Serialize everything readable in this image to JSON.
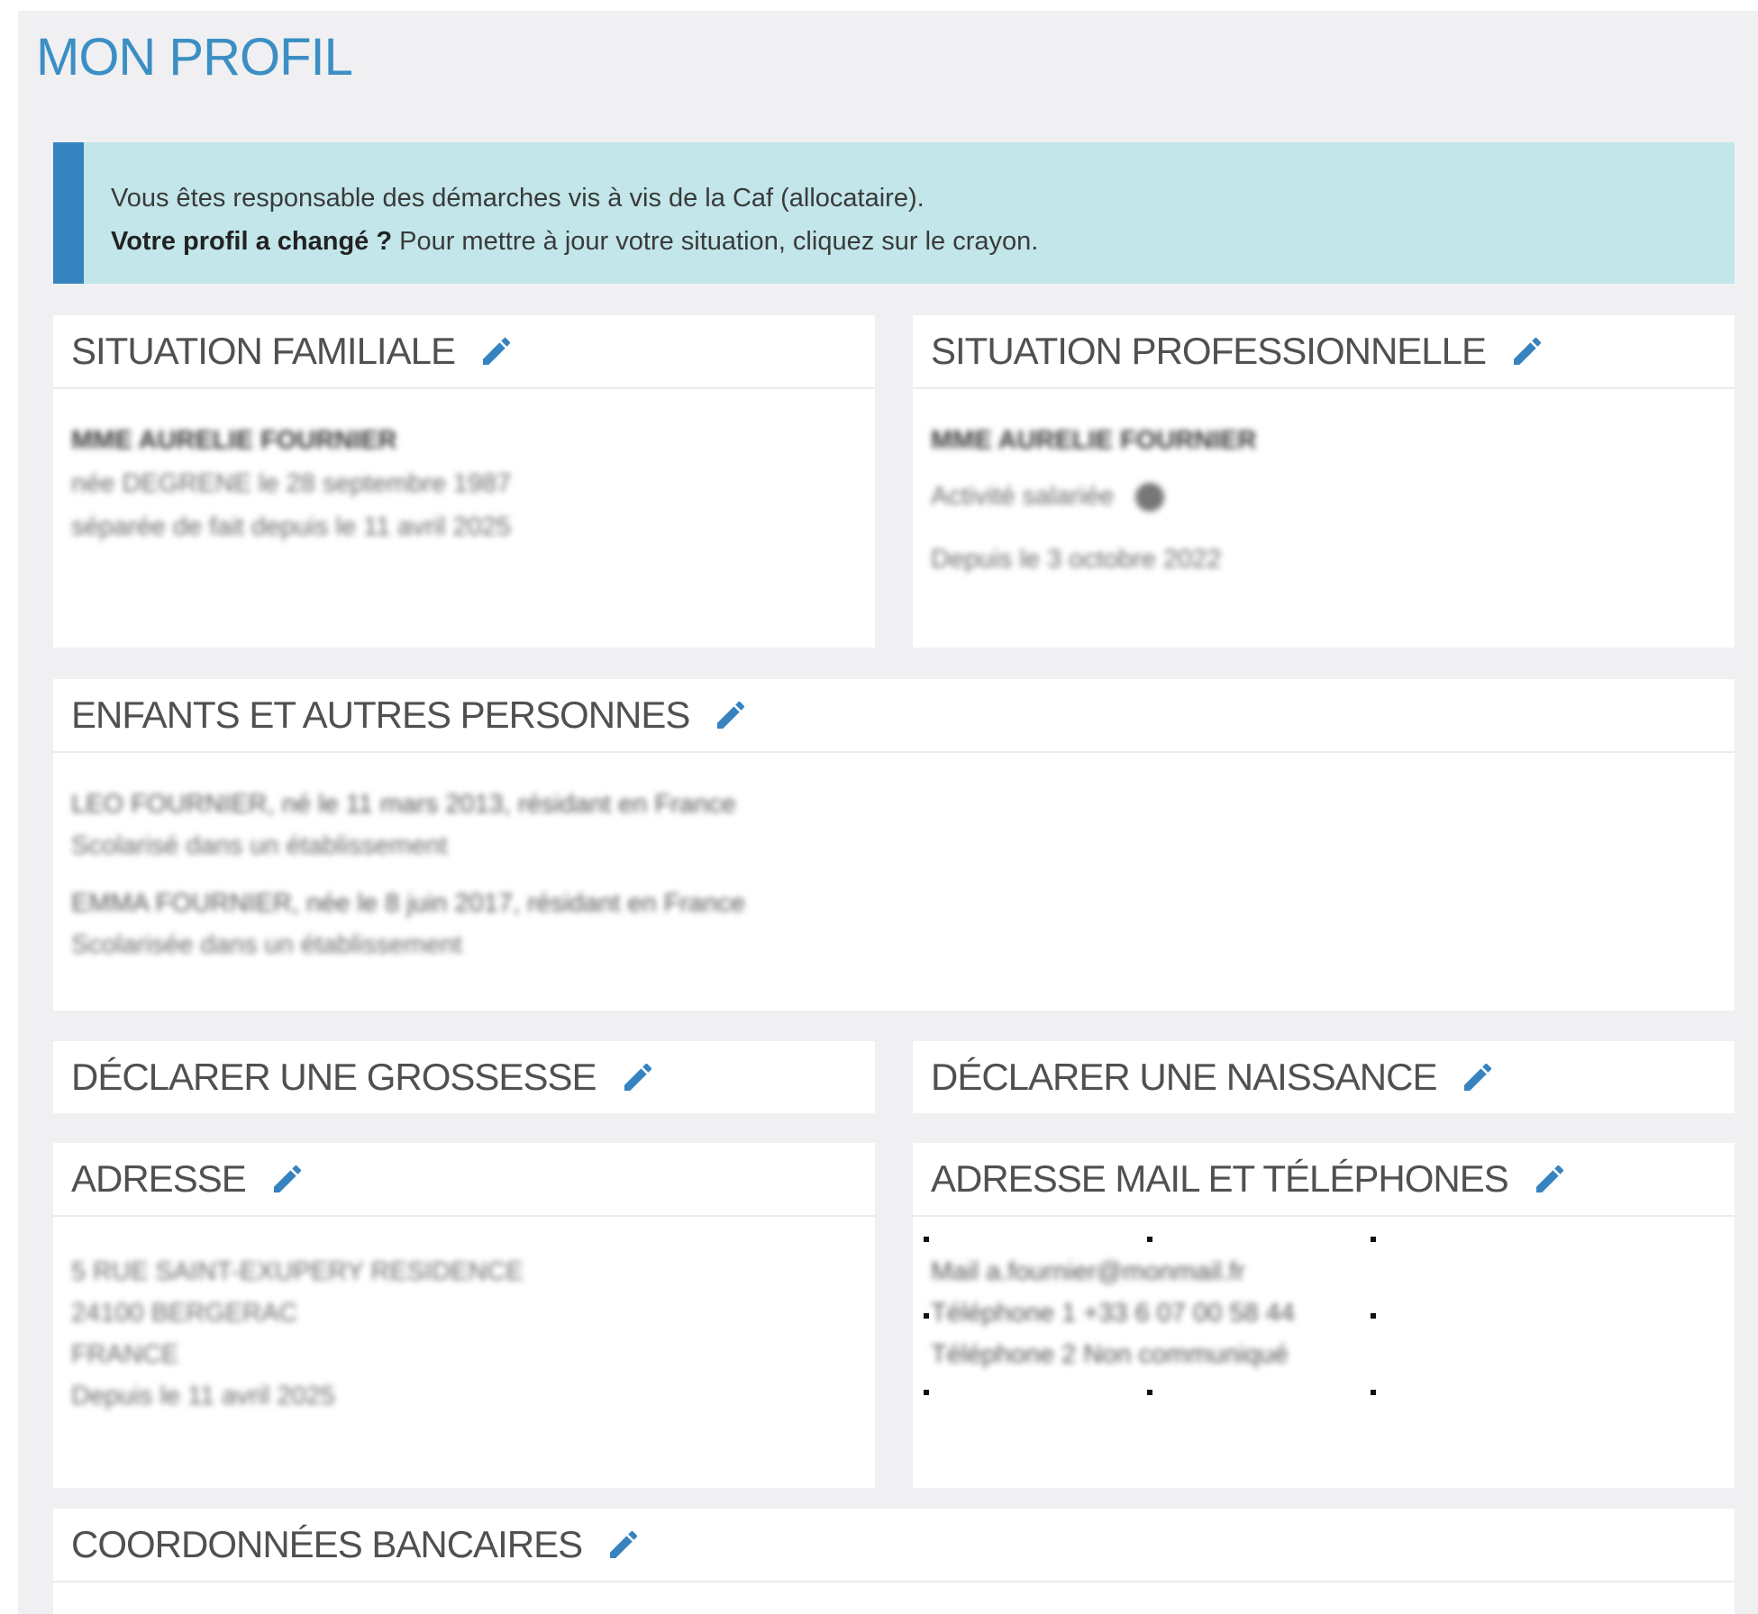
{
  "page": {
    "title": "MON PROFIL"
  },
  "info_box": {
    "line1": "Vous êtes responsable des démarches vis à vis de la Caf (allocataire).",
    "line2_bold": "Votre profil a changé ?",
    "line2_rest": " Pour mettre à jour votre situation, cliquez sur le crayon."
  },
  "cards": {
    "familiale": {
      "title": "SITUATION FAMILIALE",
      "lines": [
        "MME AURELIE FOURNIER",
        "née DEGRENE le 28 septembre 1987",
        "séparée de fait depuis le 11 avril 2025"
      ]
    },
    "professionnelle": {
      "title": "SITUATION PROFESSIONNELLE",
      "lines": [
        "MME AURELIE FOURNIER",
        "Activité salariée",
        "Depuis le 3 octobre 2022"
      ]
    },
    "enfants": {
      "title": "ENFANTS ET AUTRES PERSONNES",
      "lines": [
        "LEO FOURNIER, né le 11 mars 2013, résidant en France",
        "Scolarisé dans un établissement",
        "EMMA FOURNIER, née le 8 juin 2017, résidant en France",
        "Scolarisée dans un établissement"
      ]
    },
    "grossesse": {
      "title": "DÉCLARER UNE GROSSESSE"
    },
    "naissance": {
      "title": "DÉCLARER UNE NAISSANCE"
    },
    "adresse": {
      "title": "ADRESSE",
      "lines": [
        "5 RUE SAINT-EXUPERY RESIDENCE",
        "24100 BERGERAC",
        "FRANCE",
        "Depuis le 11 avril 2025"
      ]
    },
    "mail": {
      "title": "ADRESSE MAIL ET TÉLÉPHONES",
      "lines": [
        "Mail  a.fournier@monmail.fr",
        "Téléphone 1  +33 6 07 00 58 44",
        "Téléphone 2  Non communiqué"
      ]
    },
    "bancaires": {
      "title": "COORDONNÉES BANCAIRES"
    }
  },
  "icons": {
    "edit": "pencil-icon",
    "accent": "#3683c0"
  }
}
